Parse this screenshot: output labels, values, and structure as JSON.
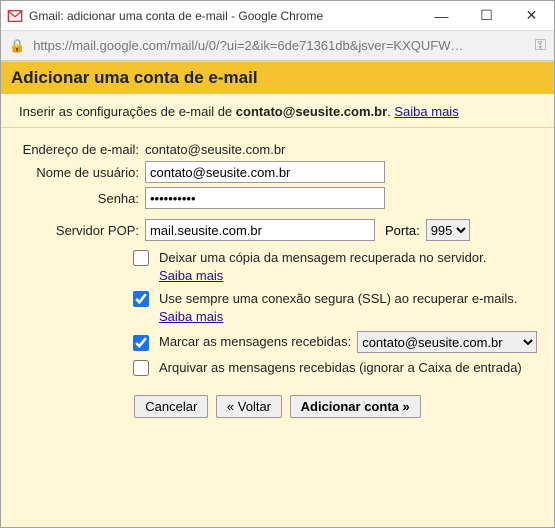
{
  "window": {
    "title": "Gmail: adicionar uma conta de e-mail - Google Chrome",
    "url": "https://mail.google.com/mail/u/0/?ui=2&ik=6de71361db&jsver=KXQUFW…"
  },
  "header": {
    "title": "Adicionar uma conta de e-mail"
  },
  "subheader": {
    "prefix": "Inserir as configurações de e-mail de ",
    "email": "contato@seusite.com.br",
    "learn_more": "Saiba mais"
  },
  "form": {
    "email_label": "Endereço de e-mail:",
    "email_value": "contato@seusite.com.br",
    "user_label": "Nome de usuário:",
    "user_value": "contato@seusite.com.br",
    "pass_label": "Senha:",
    "pass_value": "••••••••••",
    "pop_label": "Servidor POP:",
    "pop_value": "mail.seusite.com.br",
    "port_label": "Porta:",
    "port_value": "995"
  },
  "checks": {
    "leave_copy": "Deixar uma cópia da mensagem recuperada no servidor.",
    "ssl": "Use sempre uma conexão segura (SSL) ao recuperar e-mails.",
    "learn_more": "Saiba mais",
    "mark_label": "Marcar as mensagens recebidas:",
    "mark_value": "contato@seusite.com.br",
    "archive": "Arquivar as mensagens recebidas (ignorar a Caixa de entrada)"
  },
  "buttons": {
    "cancel": "Cancelar",
    "back": "« Voltar",
    "add": "Adicionar conta »"
  }
}
